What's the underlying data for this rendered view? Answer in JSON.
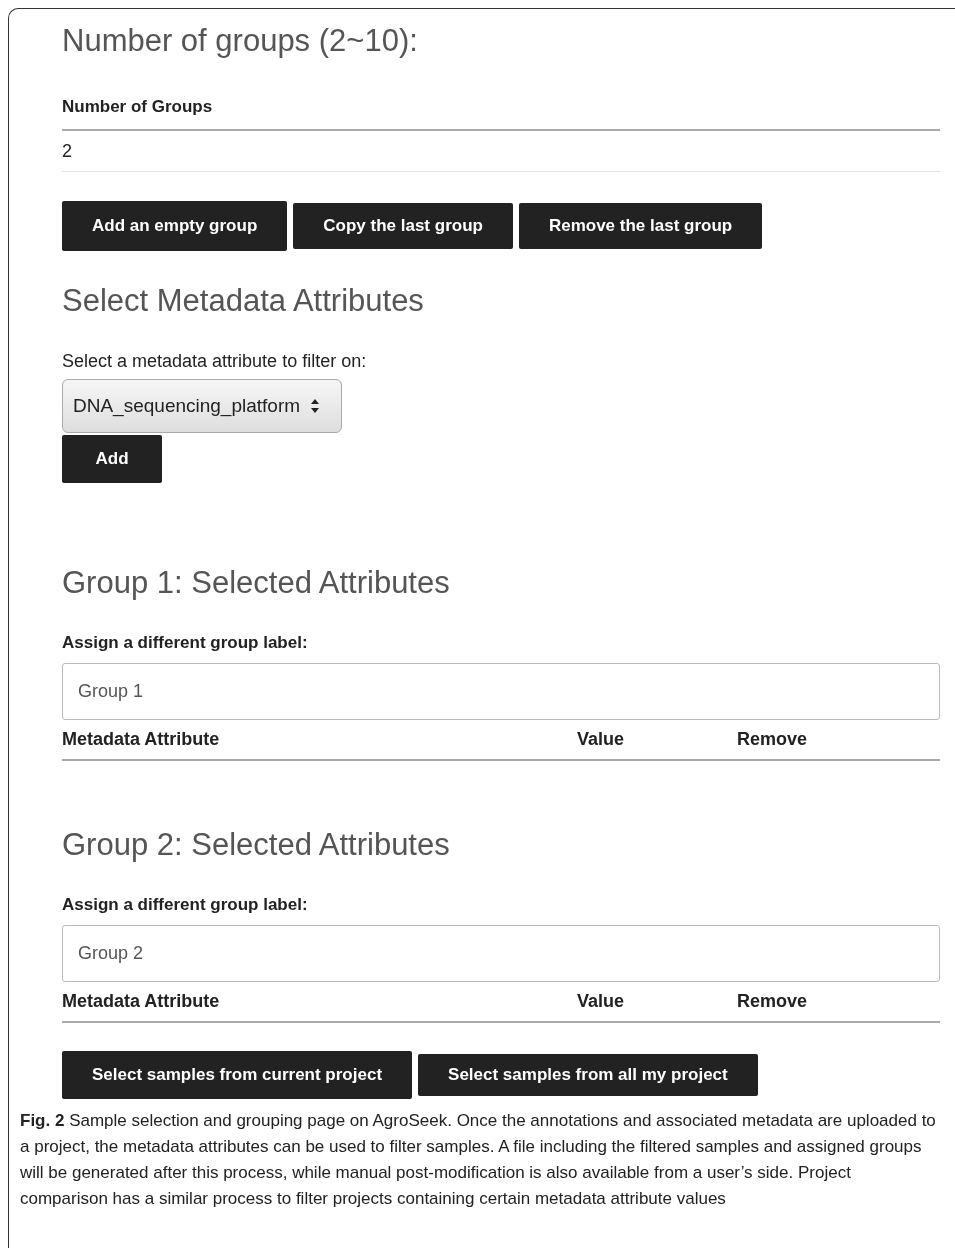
{
  "number_of_groups": {
    "heading": "Number of groups (2~10):",
    "label": "Number of Groups",
    "value": "2"
  },
  "group_buttons": [
    "Add an empty group",
    "Copy the last group",
    "Remove the last group"
  ],
  "metadata": {
    "heading": "Select Metadata Attributes",
    "label": "Select a metadata attribute to filter on:",
    "selected_option": "DNA_sequencing_platform",
    "button": "Add"
  },
  "groups": [
    {
      "heading": "Group 1: Selected Attributes",
      "prompt": "Assign a different group label:",
      "label_value": "Group 1",
      "columns": [
        "Metadata Attribute",
        "Value",
        "Remove"
      ]
    },
    {
      "heading": "Group 2: Selected Attributes",
      "prompt": "Assign a different group label:",
      "label_value": "Group 2",
      "columns": [
        "Metadata Attribute",
        "Value",
        "Remove"
      ]
    }
  ],
  "select_buttons": [
    "Select samples from current project",
    "Select samples from all my project"
  ],
  "caption": "**Fig. 2**  Sample selection and grouping page on AgroSeek. Once the annotations and associated metadata are uploaded to a project, the metadata attributes can be used to filter samples. A file including the filtered samples and assigned groups will be generated after this process, while manual post-modification is also available from a user’s side. Project comparison has a similar process to filter projects containing certain metadata attribute values"
}
